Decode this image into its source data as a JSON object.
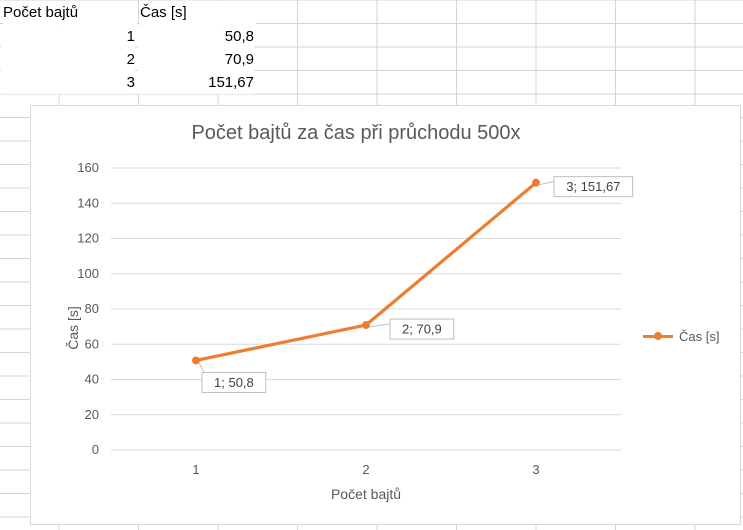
{
  "sheet": {
    "header": [
      "Počet bajtů",
      "Čas [s]"
    ],
    "rows": [
      [
        "1",
        "50,8"
      ],
      [
        "2",
        "70,9"
      ],
      [
        "3",
        "151,67"
      ]
    ]
  },
  "chart_data": {
    "type": "line",
    "title": "Počet bajtů za čas při průchodu 500x",
    "xlabel": "Počet bajtů",
    "ylabel": "Čas [s]",
    "categories": [
      "1",
      "2",
      "3"
    ],
    "series": [
      {
        "name": "Čas [s]",
        "values": [
          50.8,
          70.9,
          151.67
        ],
        "color": "#ED7D31"
      }
    ],
    "data_labels": [
      "1; 50,8",
      "2; 70,9",
      "3; 151,67"
    ],
    "ylim": [
      0,
      160
    ],
    "yticks": [
      0,
      20,
      40,
      60,
      80,
      100,
      120,
      140,
      160
    ],
    "grid": true,
    "legend": "right"
  }
}
